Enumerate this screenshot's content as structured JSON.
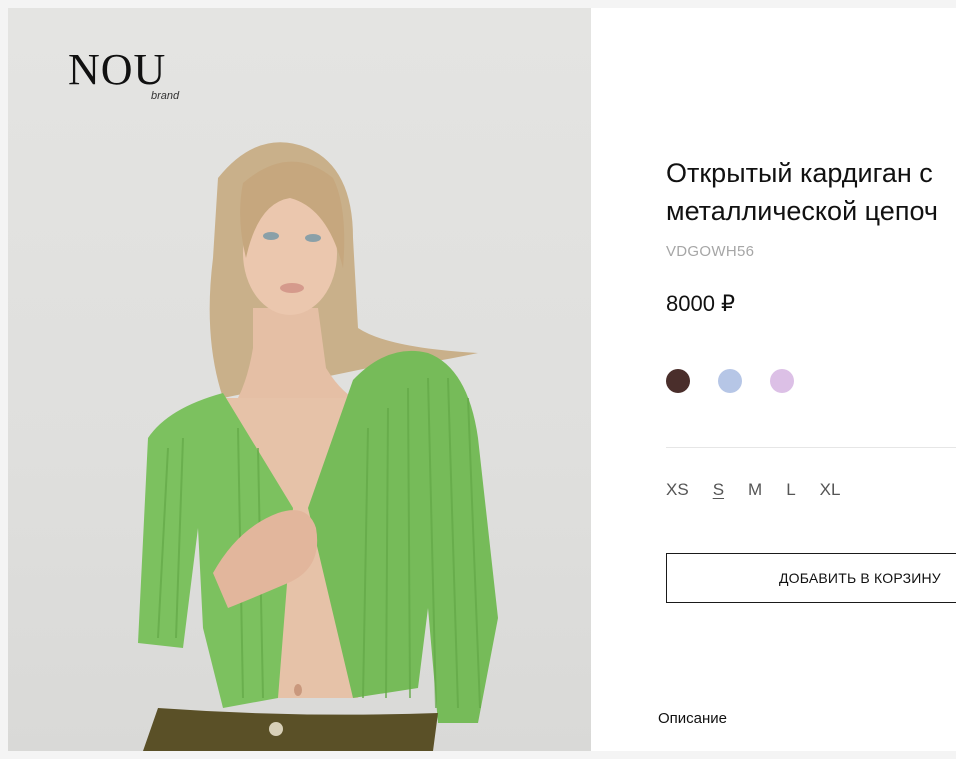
{
  "brand": {
    "logo_text": "NOU",
    "logo_sub": "brand"
  },
  "product": {
    "title": "Открытый кардиган с металлической цепочкой",
    "title_line1": "Открытый кардиган с",
    "title_line2": "металлической цепоч",
    "sku": "VDGOWH56",
    "price": "8000 ₽",
    "colors": [
      {
        "name": "brown",
        "hex": "#4a2e2b"
      },
      {
        "name": "light-blue",
        "hex": "#b6c6e6"
      },
      {
        "name": "lilac",
        "hex": "#dcc0e6"
      }
    ],
    "sizes": [
      "XS",
      "S",
      "M",
      "L",
      "XL"
    ],
    "selected_size": "S",
    "add_to_cart_label": "ДОБАВИТЬ В КОРЗИНУ",
    "description_tab": "Описание"
  },
  "photo": {
    "subject": "model-in-green-ribbed-cardigan",
    "background_color": "#e2e2e0",
    "cardigan_color": "#7cc15f",
    "pants_color": "#5a5027"
  }
}
